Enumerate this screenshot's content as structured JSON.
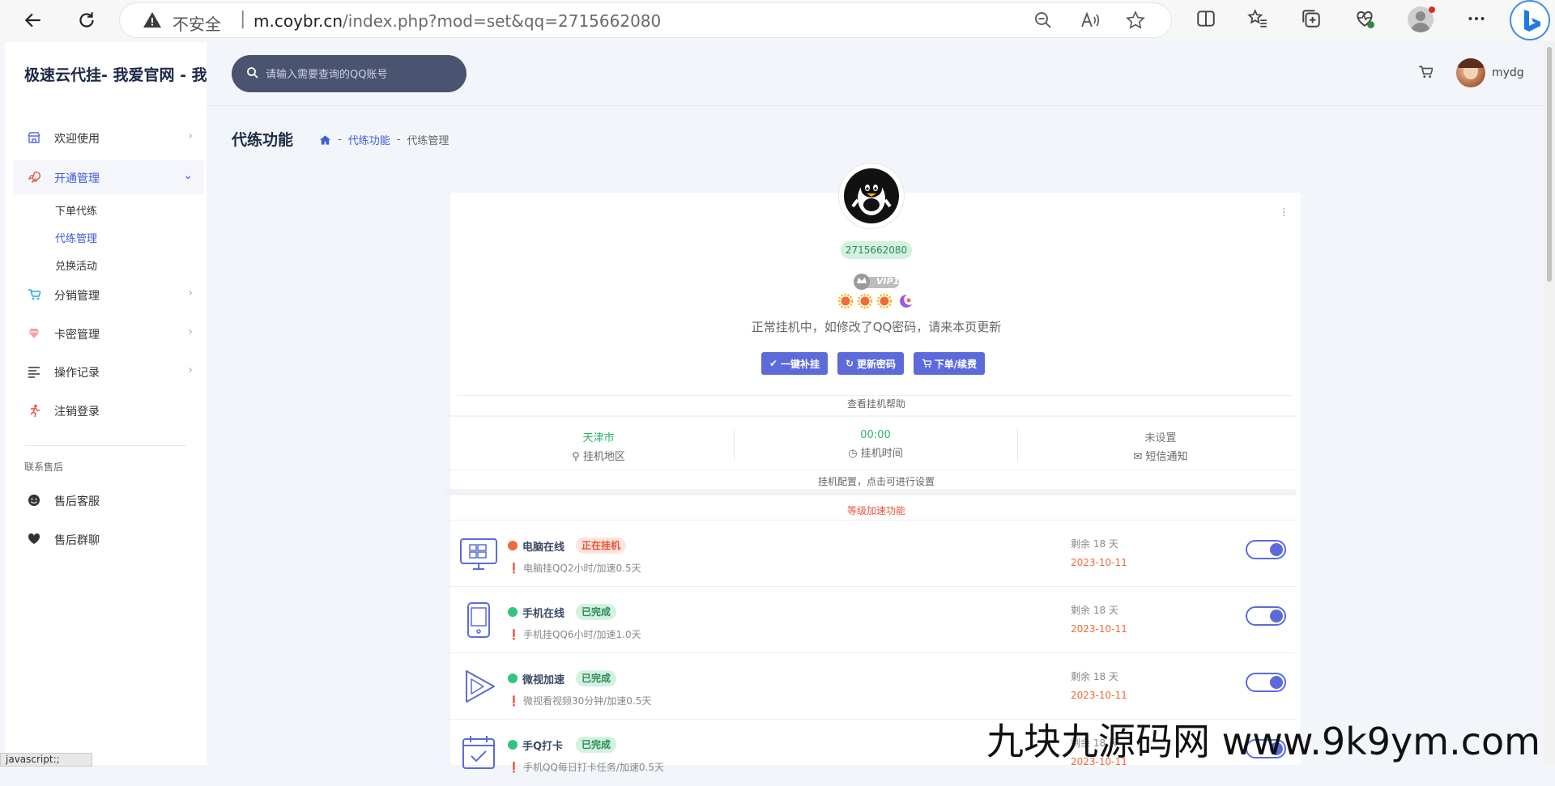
{
  "browser": {
    "insecure_label": "不安全",
    "url_host": "m.coybr.cn",
    "url_path": "/index.php?mod=set&qq=2715662080"
  },
  "sidebar": {
    "brand": "极速云代挂- 我爱官网 - 我爱官网",
    "items": [
      {
        "label": "欢迎使用",
        "icon": "store-icon"
      },
      {
        "label": "开通管理",
        "icon": "rocket-icon"
      },
      {
        "label": "分销管理",
        "icon": "cart-icon"
      },
      {
        "label": "卡密管理",
        "icon": "diamond-icon"
      },
      {
        "label": "操作记录",
        "icon": "list-icon"
      },
      {
        "label": "注销登录",
        "icon": "runner-icon"
      }
    ],
    "sub_items": [
      "下单代练",
      "代练管理",
      "兑换活动"
    ],
    "section": "联系售后",
    "support": [
      {
        "label": "售后客服",
        "icon": "smile-icon"
      },
      {
        "label": "售后群聊",
        "icon": "heart-icon"
      }
    ]
  },
  "header": {
    "search_placeholder": "请输入需要查询的QQ账号",
    "username": "mydg",
    "page_title": "代练功能",
    "breadcrumb": [
      "代练功能",
      "代练管理"
    ]
  },
  "profile": {
    "qq": "2715662080",
    "vip_label": "VIP1",
    "status": "正常挂机中，如修改了QQ密码，请来本页更新",
    "buttons": [
      "一键补挂",
      "更新密码",
      "下单/续费"
    ],
    "help": "查看挂机帮助"
  },
  "info": [
    {
      "value": "天津市",
      "key": "挂机地区",
      "color": "#2fb36a"
    },
    {
      "value": "00:00",
      "key": "挂机时间",
      "color": "#2fb36a"
    },
    {
      "value": "未设置",
      "key": "短信通知",
      "color": "#777777"
    }
  ],
  "config_text": "挂机配置，点击可进行设置",
  "boost_title": "等级加速功能",
  "features": [
    {
      "title": "电脑在线",
      "tag": "正在挂机",
      "tag_style": "running",
      "dot": "#f06a3a",
      "desc": "电脑挂QQ2小时/加速0.5天",
      "remain": "剩余 18 天",
      "date": "2023-10-11",
      "icon": "desktop-icon",
      "enabled": true
    },
    {
      "title": "手机在线",
      "tag": "已完成",
      "tag_style": "done",
      "dot": "#2fc57e",
      "desc": "手机挂QQ6小时/加速1.0天",
      "remain": "剩余 18 天",
      "date": "2023-10-11",
      "icon": "tablet-icon",
      "enabled": true
    },
    {
      "title": "微视加速",
      "tag": "已完成",
      "tag_style": "done",
      "dot": "#2fc57e",
      "desc": "微视看视频30分钟/加速0.5天",
      "remain": "剩余 18 天",
      "date": "2023-10-11",
      "icon": "play-icon",
      "enabled": true
    },
    {
      "title": "手Q打卡",
      "tag": "已完成",
      "tag_style": "done",
      "dot": "#2fc57e",
      "desc": "手机QQ每日打卡任务/加速0.5天",
      "remain": "剩余 18 天",
      "date": "2023-10-11",
      "icon": "calendar-check-icon",
      "enabled": true
    }
  ],
  "watermark": "九块九源码网 www.9k9ym.com",
  "status_bar": "javascript:;"
}
